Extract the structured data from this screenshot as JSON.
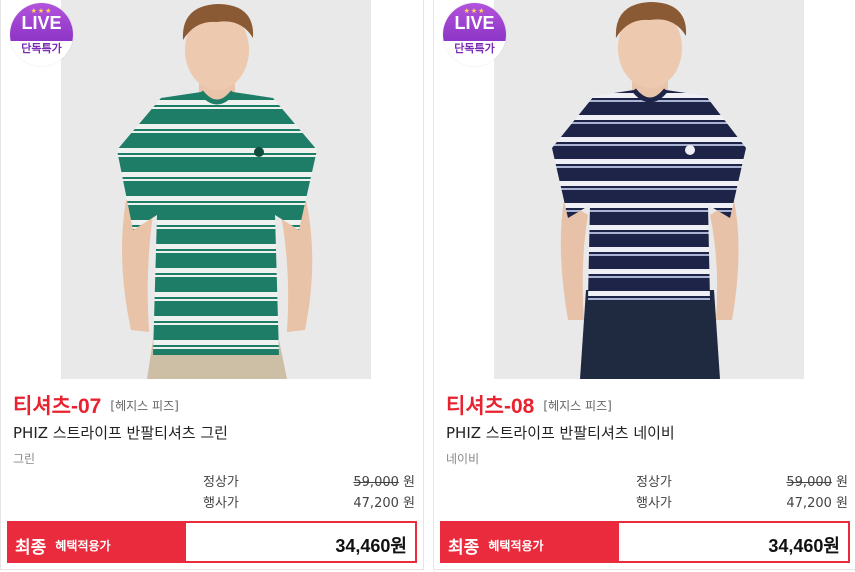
{
  "products": [
    {
      "badge": {
        "stars": "★★★",
        "live": "LIVE",
        "label": "단독특가"
      },
      "code": "티셔츠-07",
      "brand": "[헤지스 피즈]",
      "name": "PHIZ 스트라이프 반팔티셔츠 그린",
      "color": "그린",
      "regular_label": "정상가",
      "regular_price": "59,000",
      "event_label": "행사가",
      "event_price": "47,200",
      "won": "원",
      "final_big": "최종",
      "final_small": "혜택적용가",
      "final_price": "34,460원",
      "shirt_color": "#1e7d67",
      "stripe_color": "#eef2ef"
    },
    {
      "badge": {
        "stars": "★★★",
        "live": "LIVE",
        "label": "단독특가"
      },
      "code": "티셔츠-08",
      "brand": "[헤지스 피즈]",
      "name": "PHIZ 스트라이프 반팔티셔츠 네이비",
      "color": "네이비",
      "regular_label": "정상가",
      "regular_price": "59,000",
      "event_label": "행사가",
      "event_price": "47,200",
      "won": "원",
      "final_big": "최종",
      "final_small": "혜택적용가",
      "final_price": "34,460원",
      "shirt_color": "#1d2447",
      "stripe_color": "#eef0f5"
    }
  ]
}
